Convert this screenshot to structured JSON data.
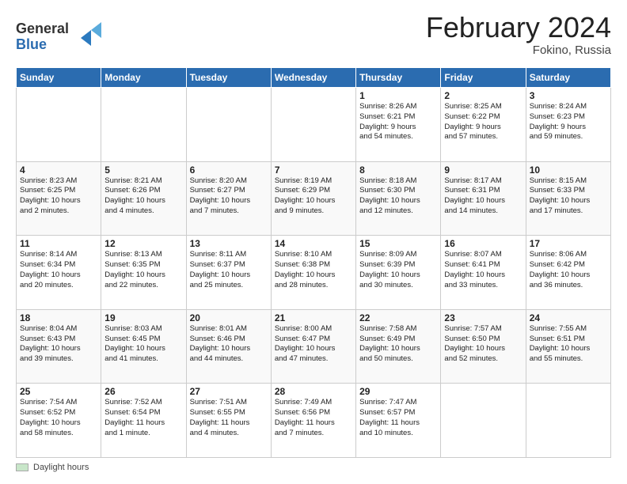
{
  "logo": {
    "line1": "General",
    "line2": "Blue"
  },
  "title": "February 2024",
  "subtitle": "Fokino, Russia",
  "days_of_week": [
    "Sunday",
    "Monday",
    "Tuesday",
    "Wednesday",
    "Thursday",
    "Friday",
    "Saturday"
  ],
  "weeks": [
    [
      {
        "day": "",
        "info": ""
      },
      {
        "day": "",
        "info": ""
      },
      {
        "day": "",
        "info": ""
      },
      {
        "day": "",
        "info": ""
      },
      {
        "day": "1",
        "info": "Sunrise: 8:26 AM\nSunset: 6:21 PM\nDaylight: 9 hours\nand 54 minutes."
      },
      {
        "day": "2",
        "info": "Sunrise: 8:25 AM\nSunset: 6:22 PM\nDaylight: 9 hours\nand 57 minutes."
      },
      {
        "day": "3",
        "info": "Sunrise: 8:24 AM\nSunset: 6:23 PM\nDaylight: 9 hours\nand 59 minutes."
      }
    ],
    [
      {
        "day": "4",
        "info": "Sunrise: 8:23 AM\nSunset: 6:25 PM\nDaylight: 10 hours\nand 2 minutes."
      },
      {
        "day": "5",
        "info": "Sunrise: 8:21 AM\nSunset: 6:26 PM\nDaylight: 10 hours\nand 4 minutes."
      },
      {
        "day": "6",
        "info": "Sunrise: 8:20 AM\nSunset: 6:27 PM\nDaylight: 10 hours\nand 7 minutes."
      },
      {
        "day": "7",
        "info": "Sunrise: 8:19 AM\nSunset: 6:29 PM\nDaylight: 10 hours\nand 9 minutes."
      },
      {
        "day": "8",
        "info": "Sunrise: 8:18 AM\nSunset: 6:30 PM\nDaylight: 10 hours\nand 12 minutes."
      },
      {
        "day": "9",
        "info": "Sunrise: 8:17 AM\nSunset: 6:31 PM\nDaylight: 10 hours\nand 14 minutes."
      },
      {
        "day": "10",
        "info": "Sunrise: 8:15 AM\nSunset: 6:33 PM\nDaylight: 10 hours\nand 17 minutes."
      }
    ],
    [
      {
        "day": "11",
        "info": "Sunrise: 8:14 AM\nSunset: 6:34 PM\nDaylight: 10 hours\nand 20 minutes."
      },
      {
        "day": "12",
        "info": "Sunrise: 8:13 AM\nSunset: 6:35 PM\nDaylight: 10 hours\nand 22 minutes."
      },
      {
        "day": "13",
        "info": "Sunrise: 8:11 AM\nSunset: 6:37 PM\nDaylight: 10 hours\nand 25 minutes."
      },
      {
        "day": "14",
        "info": "Sunrise: 8:10 AM\nSunset: 6:38 PM\nDaylight: 10 hours\nand 28 minutes."
      },
      {
        "day": "15",
        "info": "Sunrise: 8:09 AM\nSunset: 6:39 PM\nDaylight: 10 hours\nand 30 minutes."
      },
      {
        "day": "16",
        "info": "Sunrise: 8:07 AM\nSunset: 6:41 PM\nDaylight: 10 hours\nand 33 minutes."
      },
      {
        "day": "17",
        "info": "Sunrise: 8:06 AM\nSunset: 6:42 PM\nDaylight: 10 hours\nand 36 minutes."
      }
    ],
    [
      {
        "day": "18",
        "info": "Sunrise: 8:04 AM\nSunset: 6:43 PM\nDaylight: 10 hours\nand 39 minutes."
      },
      {
        "day": "19",
        "info": "Sunrise: 8:03 AM\nSunset: 6:45 PM\nDaylight: 10 hours\nand 41 minutes."
      },
      {
        "day": "20",
        "info": "Sunrise: 8:01 AM\nSunset: 6:46 PM\nDaylight: 10 hours\nand 44 minutes."
      },
      {
        "day": "21",
        "info": "Sunrise: 8:00 AM\nSunset: 6:47 PM\nDaylight: 10 hours\nand 47 minutes."
      },
      {
        "day": "22",
        "info": "Sunrise: 7:58 AM\nSunset: 6:49 PM\nDaylight: 10 hours\nand 50 minutes."
      },
      {
        "day": "23",
        "info": "Sunrise: 7:57 AM\nSunset: 6:50 PM\nDaylight: 10 hours\nand 52 minutes."
      },
      {
        "day": "24",
        "info": "Sunrise: 7:55 AM\nSunset: 6:51 PM\nDaylight: 10 hours\nand 55 minutes."
      }
    ],
    [
      {
        "day": "25",
        "info": "Sunrise: 7:54 AM\nSunset: 6:52 PM\nDaylight: 10 hours\nand 58 minutes."
      },
      {
        "day": "26",
        "info": "Sunrise: 7:52 AM\nSunset: 6:54 PM\nDaylight: 11 hours\nand 1 minute."
      },
      {
        "day": "27",
        "info": "Sunrise: 7:51 AM\nSunset: 6:55 PM\nDaylight: 11 hours\nand 4 minutes."
      },
      {
        "day": "28",
        "info": "Sunrise: 7:49 AM\nSunset: 6:56 PM\nDaylight: 11 hours\nand 7 minutes."
      },
      {
        "day": "29",
        "info": "Sunrise: 7:47 AM\nSunset: 6:57 PM\nDaylight: 11 hours\nand 10 minutes."
      },
      {
        "day": "",
        "info": ""
      },
      {
        "day": "",
        "info": ""
      }
    ]
  ],
  "footer": {
    "legend_label": "Daylight hours"
  }
}
